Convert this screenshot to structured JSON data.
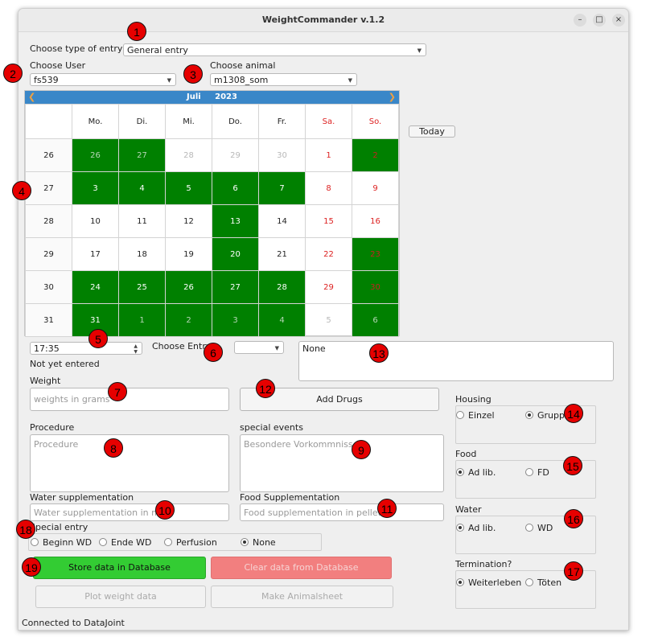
{
  "window": {
    "title": "WeightCommander v.1.2"
  },
  "entry_type": {
    "label": "Choose type of entry",
    "value": "General entry"
  },
  "user": {
    "label": "Choose User",
    "value": "fs539"
  },
  "animal": {
    "label": "Choose animal",
    "value": "m1308_som"
  },
  "calendar": {
    "month": "Juli",
    "year": "2023",
    "today_button": "Today",
    "weekdays": [
      "Mo.",
      "Di.",
      "Mi.",
      "Do.",
      "Fr.",
      "Sa.",
      "So."
    ],
    "weeks": [
      {
        "week": "26",
        "days": [
          {
            "d": "26",
            "g": true,
            "dim": true
          },
          {
            "d": "27",
            "g": true,
            "dim": true
          },
          {
            "d": "28",
            "g": false,
            "dim": true
          },
          {
            "d": "29",
            "g": false,
            "dim": true
          },
          {
            "d": "30",
            "g": false,
            "dim": true
          },
          {
            "d": "1",
            "g": false,
            "dim": false
          },
          {
            "d": "2",
            "g": true,
            "dim": false
          }
        ]
      },
      {
        "week": "27",
        "days": [
          {
            "d": "3",
            "g": true
          },
          {
            "d": "4",
            "g": true
          },
          {
            "d": "5",
            "g": true
          },
          {
            "d": "6",
            "g": true
          },
          {
            "d": "7",
            "g": true
          },
          {
            "d": "8",
            "g": false
          },
          {
            "d": "9",
            "g": false
          }
        ]
      },
      {
        "week": "28",
        "days": [
          {
            "d": "10",
            "g": false
          },
          {
            "d": "11",
            "g": false
          },
          {
            "d": "12",
            "g": false
          },
          {
            "d": "13",
            "g": true
          },
          {
            "d": "14",
            "g": false
          },
          {
            "d": "15",
            "g": false
          },
          {
            "d": "16",
            "g": false
          }
        ]
      },
      {
        "week": "29",
        "days": [
          {
            "d": "17",
            "g": false
          },
          {
            "d": "18",
            "g": false
          },
          {
            "d": "19",
            "g": false
          },
          {
            "d": "20",
            "g": true
          },
          {
            "d": "21",
            "g": false
          },
          {
            "d": "22",
            "g": false
          },
          {
            "d": "23",
            "g": true
          }
        ]
      },
      {
        "week": "30",
        "days": [
          {
            "d": "24",
            "g": true
          },
          {
            "d": "25",
            "g": true
          },
          {
            "d": "26",
            "g": true
          },
          {
            "d": "27",
            "g": true
          },
          {
            "d": "28",
            "g": true
          },
          {
            "d": "29",
            "g": false
          },
          {
            "d": "30",
            "g": true
          }
        ]
      },
      {
        "week": "31",
        "days": [
          {
            "d": "31",
            "g": true
          },
          {
            "d": "1",
            "g": true,
            "dim": true
          },
          {
            "d": "2",
            "g": true,
            "dim": true
          },
          {
            "d": "3",
            "g": true,
            "dim": true
          },
          {
            "d": "4",
            "g": true,
            "dim": true
          },
          {
            "d": "5",
            "g": false,
            "dim": true
          },
          {
            "d": "6",
            "g": true,
            "dim": true
          }
        ]
      }
    ]
  },
  "time": {
    "value": "17:35",
    "status": "Not yet entered"
  },
  "choose_entry": {
    "label": "Choose Entry",
    "value": ""
  },
  "notes_box": {
    "value": "None"
  },
  "weight": {
    "label": "Weight",
    "placeholder": "weights in grams"
  },
  "add_drugs_button": "Add Drugs",
  "procedure": {
    "label": "Procedure",
    "placeholder": "Procedure"
  },
  "special_events": {
    "label": "special events",
    "placeholder": "Besondere Vorkommnisse"
  },
  "water_supp": {
    "label": "Water supplementation",
    "placeholder": "Water supplementation in ml"
  },
  "food_supp": {
    "label": "Food Supplementation",
    "placeholder": "Food supplementation in pellets"
  },
  "special_entry": {
    "label": "Special entry",
    "options": [
      "Beginn WD",
      "Ende WD",
      "Perfusion",
      "None"
    ],
    "selected": "None"
  },
  "housing": {
    "label": "Housing",
    "options": [
      "Einzel",
      "Gruppe"
    ],
    "selected": "Gruppe"
  },
  "food": {
    "label": "Food",
    "options": [
      "Ad lib.",
      "FD"
    ],
    "selected": "Ad lib."
  },
  "water": {
    "label": "Water",
    "options": [
      "Ad lib.",
      "WD"
    ],
    "selected": "Ad lib."
  },
  "termination": {
    "label": "Termination?",
    "options": [
      "Weiterleben",
      "Töten"
    ],
    "selected": "Weiterleben"
  },
  "buttons": {
    "store": "Store data in Database",
    "clear": "Clear data from Database",
    "plot": "Plot weight data",
    "animalsheet": "Make Animalsheet"
  },
  "status_bar": "Connected to DataJoint",
  "annotations": [
    "1",
    "2",
    "3",
    "4",
    "5",
    "6",
    "7",
    "8",
    "9",
    "10",
    "11",
    "12",
    "13",
    "14",
    "15",
    "16",
    "17",
    "18",
    "19"
  ],
  "colors": {
    "calendar_header": "#3a87c8",
    "marked_day": "#008000",
    "store_button": "#33cc33",
    "clear_button": "#f27f7f",
    "badge": "#e60000"
  }
}
